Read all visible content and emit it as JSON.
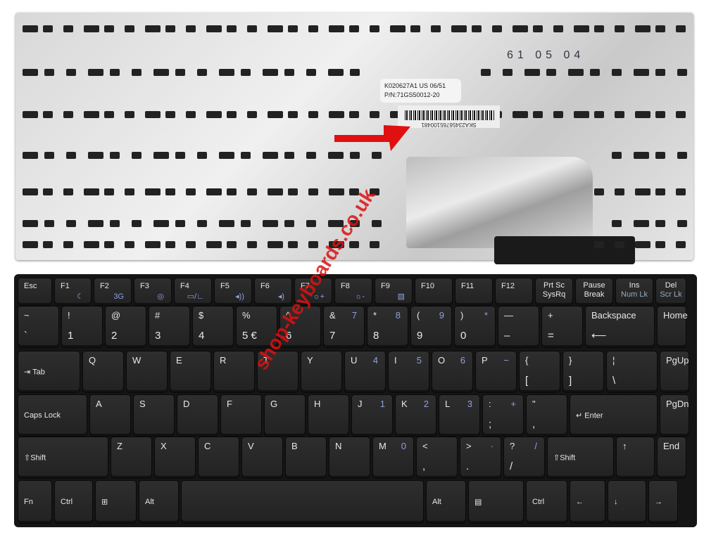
{
  "photo": {
    "sticker": {
      "line1": "K020627A1 US 06/51",
      "line2": "P/N:71GS50012-20"
    },
    "barcode_text": "SKA23456765100481",
    "handwritten": "61 05 04",
    "watermark": "shop-keyboards.co.uk",
    "colors": {
      "plate": "#d8d8d8",
      "keys": "#222222",
      "fn_label": "#8da0e0",
      "arrow": "#e01010",
      "watermark": "#d11111"
    }
  },
  "keyboard": {
    "rows": [
      [
        {
          "t": "Esc"
        },
        {
          "t": "F1",
          "s": "☾"
        },
        {
          "t": "F2",
          "s": "3G"
        },
        {
          "t": "F3",
          "s": "◎"
        },
        {
          "t": "F4",
          "s": "▭/∟"
        },
        {
          "t": "F5",
          "s": "◂))"
        },
        {
          "t": "F6",
          "s": "◂)"
        },
        {
          "t": "F7",
          "s": "☼+"
        },
        {
          "t": "F8",
          "s": "☼-"
        },
        {
          "t": "F9",
          "s": "▨"
        },
        {
          "t": "F10"
        },
        {
          "t": "F11"
        },
        {
          "t": "F12"
        },
        {
          "t": "Prt Sc",
          "b": "SysRq"
        },
        {
          "t": "Pause",
          "b": "Break"
        },
        {
          "t": "Ins",
          "s": "Num Lk"
        },
        {
          "t": "Del",
          "s": "Scr Lk"
        }
      ],
      [
        {
          "t": "~",
          "b": "`"
        },
        {
          "t": "!",
          "b": "1"
        },
        {
          "t": "@",
          "b": "2"
        },
        {
          "t": "#",
          "b": "3"
        },
        {
          "t": "$",
          "b": "4"
        },
        {
          "t": "%",
          "b": "5 €"
        },
        {
          "t": "^",
          "b": "6"
        },
        {
          "t": "&",
          "b": "7",
          "s": "7"
        },
        {
          "t": "*",
          "b": "8",
          "s": "8"
        },
        {
          "t": "(",
          "b": "9",
          "s": "9"
        },
        {
          "t": ")",
          "b": "0",
          "s": "*"
        },
        {
          "t": "—",
          "b": "–"
        },
        {
          "t": "+",
          "b": "="
        },
        {
          "t": "Backspace",
          "b": "⟵"
        },
        {
          "t": "Home"
        }
      ],
      [
        {
          "t": "⇥ Tab"
        },
        {
          "t": "Q"
        },
        {
          "t": "W"
        },
        {
          "t": "E"
        },
        {
          "t": "R"
        },
        {
          "t": "T"
        },
        {
          "t": "Y"
        },
        {
          "t": "U",
          "s": "4"
        },
        {
          "t": "I",
          "s": "5"
        },
        {
          "t": "O",
          "s": "6"
        },
        {
          "t": "P",
          "s": "−"
        },
        {
          "t": "{",
          "b": "["
        },
        {
          "t": "}",
          "b": "]"
        },
        {
          "t": "¦",
          "b": "\\"
        },
        {
          "t": "PgUp"
        }
      ],
      [
        {
          "t": "Caps Lock"
        },
        {
          "t": "A"
        },
        {
          "t": "S"
        },
        {
          "t": "D"
        },
        {
          "t": "F"
        },
        {
          "t": "G"
        },
        {
          "t": "H"
        },
        {
          "t": "J",
          "s": "1"
        },
        {
          "t": "K",
          "s": "2"
        },
        {
          "t": "L",
          "s": "3"
        },
        {
          "t": ":",
          "b": ";",
          "s": "+"
        },
        {
          "t": "\"",
          "b": ","
        },
        {
          "t": "↵ Enter"
        },
        {
          "t": "PgDn"
        }
      ],
      [
        {
          "t": "⇧Shift"
        },
        {
          "t": "Z"
        },
        {
          "t": "X"
        },
        {
          "t": "C"
        },
        {
          "t": "V"
        },
        {
          "t": "B"
        },
        {
          "t": "N"
        },
        {
          "t": "M",
          "s": "0"
        },
        {
          "t": "<",
          "b": ","
        },
        {
          "t": ">",
          "b": ".",
          "s": "·"
        },
        {
          "t": "?",
          "b": "/",
          "s": "/"
        },
        {
          "t": "⇧Shift"
        },
        {
          "t": "↑"
        },
        {
          "t": "End"
        }
      ],
      [
        {
          "t": "Fn"
        },
        {
          "t": "Ctrl"
        },
        {
          "t": "⊞"
        },
        {
          "t": "Alt"
        },
        {
          "t": ""
        },
        {
          "t": "Alt"
        },
        {
          "t": "▤"
        },
        {
          "t": "Ctrl"
        },
        {
          "t": "←"
        },
        {
          "t": "↓"
        },
        {
          "t": "→"
        }
      ]
    ]
  }
}
